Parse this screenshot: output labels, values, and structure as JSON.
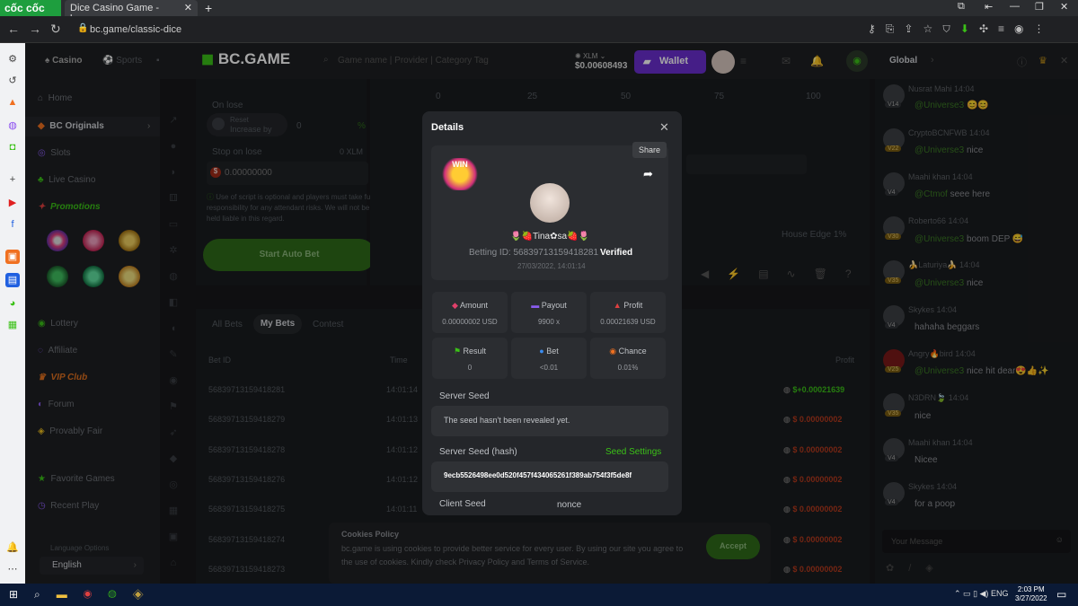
{
  "browser": {
    "brand": "cốc cốc",
    "tab_title": "Dice Casino Game - bc.game",
    "url": "bc.game/classic-dice"
  },
  "site": {
    "logo": "BC.GAME",
    "tabs": {
      "casino": "Casino",
      "sports": "Sports"
    },
    "search_placeholder": "Game name | Provider | Category Tag",
    "balance_currency": "XLM",
    "balance": "$0.00608493",
    "wallet_label": "Wallet"
  },
  "nav": {
    "home": "Home",
    "originals": "BC Originals",
    "slots": "Slots",
    "live": "Live Casino",
    "promotions": "Promotions",
    "lottery": "Lottery",
    "affiliate": "Affiliate",
    "vip": "VIP Club",
    "forum": "Forum",
    "provably": "Provably Fair",
    "favorites": "Favorite Games",
    "recent": "Recent Play",
    "language_label": "Language Options",
    "language": "English"
  },
  "game": {
    "on_lose": "On lose",
    "reset": "Reset",
    "increase_by": "Increase by",
    "increase_value": "0",
    "percent": "%",
    "stop_on_lose": "Stop on lose",
    "stop_unit": "0 XLM",
    "stop_value": "0.00000000",
    "disclaimer": "Use of script is optional and players must take full responsibility for any attendant risks. We will not be held liable in this regard.",
    "start_auto": "Start Auto Bet",
    "scale": [
      "0",
      "25",
      "50",
      "75",
      "100"
    ],
    "house_edge": "House Edge 1%",
    "tabs": [
      "All Bets",
      "My Bets",
      "Contest"
    ],
    "col_betid": "Bet ID",
    "col_time": "Time",
    "col_profit": "Profit"
  },
  "bets": [
    {
      "id": "56839713159418281",
      "time": "14:01:14",
      "profit": "$+0.00021639"
    },
    {
      "id": "56839713159418279",
      "time": "14:01:13",
      "profit": "$ 0.00000002"
    },
    {
      "id": "56839713159418278",
      "time": "14:01:12",
      "profit": "$ 0.00000002"
    },
    {
      "id": "56839713159418276",
      "time": "14:01:12",
      "profit": "$ 0.00000002"
    },
    {
      "id": "56839713159418275",
      "time": "14:01:11",
      "profit": "$ 0.00000002"
    },
    {
      "id": "56839713159418274",
      "time": "",
      "profit": "$ 0.00000002"
    },
    {
      "id": "56839713159418273",
      "time": "",
      "profit": "$ 0.00000002"
    }
  ],
  "cookies": {
    "title": "Cookies Policy",
    "text": "bc.game is using cookies to provide better service for every user. By using our site you agree to the use of cookies. Kindly check Privacy Policy and Terms of Service.",
    "accept": "Accept"
  },
  "modal": {
    "title": "Details",
    "share": "Share",
    "win": "WIN",
    "username": "🌷🍓Tina✿sa🍓🌷",
    "bet_id": "Betting ID: 56839713159418281",
    "verified": "Verified",
    "date": "27/03/2022, 14:01:14",
    "stats": [
      {
        "label": "Amount",
        "value": "0.00000002 USD",
        "color": "#e0406a"
      },
      {
        "label": "Payout",
        "value": "9900 x",
        "color": "#8a5cf0"
      },
      {
        "label": "Profit",
        "value": "0.00021639 USD",
        "color": "#e04040"
      },
      {
        "label": "Result",
        "value": "0",
        "color": "#3bc117"
      },
      {
        "label": "Bet",
        "value": "<0.01",
        "color": "#3a8cf0"
      },
      {
        "label": "Chance",
        "value": "0.01%",
        "color": "#f07020"
      }
    ],
    "server_seed_label": "Server Seed",
    "server_seed": "The seed hasn't been revealed yet.",
    "hash_label": "Server Seed (hash)",
    "seed_settings": "Seed Settings",
    "hash": "9ecb5526498ee0d520f457f434065261f389ab754f3f5de8f",
    "client_seed_label": "Client Seed",
    "nonce_label": "nonce"
  },
  "chat": {
    "title": "Global",
    "input_placeholder": "Your Message",
    "messages": [
      {
        "name": "Nusrat Mahi",
        "time": "14:04",
        "level": "V14",
        "mention": "@Universe3",
        "text": "😊😊"
      },
      {
        "name": "CryptoBCNFWB",
        "time": "14:04",
        "level": "V22",
        "mention": "@Universe3",
        "text": "nice"
      },
      {
        "name": "Maahi khan",
        "time": "14:04",
        "level": "V4",
        "mention": "@Ctmof",
        "text": "seee here"
      },
      {
        "name": "Roberto66",
        "time": "14:04",
        "level": "V30",
        "mention": "@Universe3",
        "text": "boom DEP 😅"
      },
      {
        "name": "🍌Laturiya🍌",
        "time": "14:04",
        "level": "V35",
        "mention": "@Universe3",
        "text": "nice"
      },
      {
        "name": "Skykes",
        "time": "14:04",
        "level": "V4",
        "mention": "",
        "text": "hahaha beggars"
      },
      {
        "name": "Angry🔥bird",
        "time": "14:04",
        "level": "V25",
        "mention": "@Universe3",
        "text": "nice hit dear😍👍✨"
      },
      {
        "name": "N3DRN🍃",
        "time": "14:04",
        "level": "V35",
        "mention": "",
        "text": "nice"
      },
      {
        "name": "Maahi khan",
        "time": "14:04",
        "level": "V4",
        "mention": "",
        "text": "Nicee"
      },
      {
        "name": "Skykes",
        "time": "14:04",
        "level": "V4",
        "mention": "",
        "text": "for a poop"
      }
    ]
  },
  "taskbar": {
    "lang": "ENG",
    "time": "2:03 PM",
    "date": "3/27/2022"
  }
}
